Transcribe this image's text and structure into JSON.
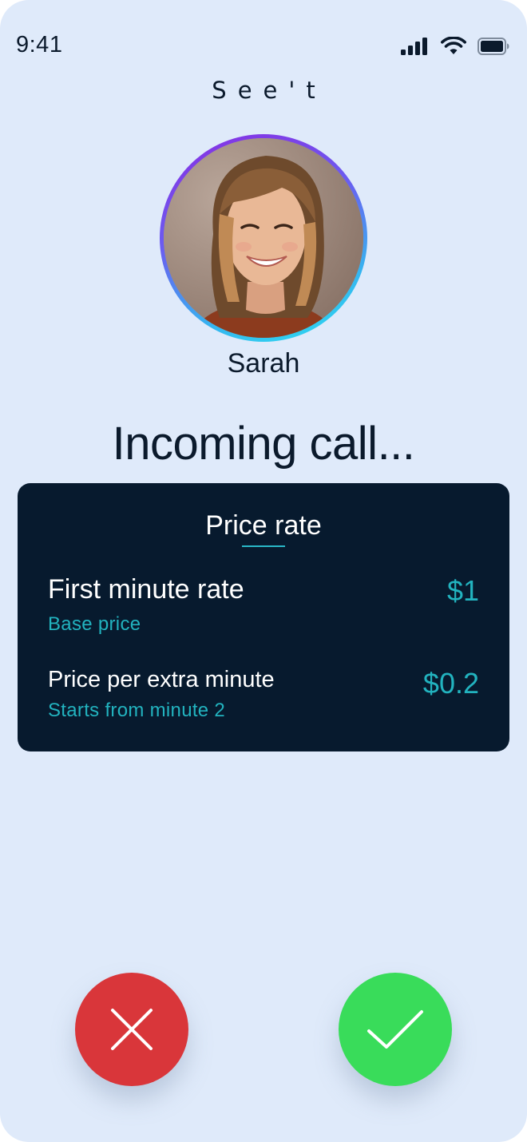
{
  "status_bar": {
    "time": "9:41",
    "icons": [
      "cellular-signal-icon",
      "wifi-icon",
      "battery-icon"
    ]
  },
  "app": {
    "logo_text": "See't"
  },
  "caller": {
    "name": "Sarah",
    "avatar": "caller-photo"
  },
  "call": {
    "status_text": "Incoming call..."
  },
  "price_rate": {
    "title": "Price rate",
    "items": [
      {
        "label": "First minute rate",
        "sublabel": "Base price",
        "value": "$1"
      },
      {
        "label": "Price per extra minute",
        "sublabel": "Starts from minute 2",
        "value": "$0.2"
      }
    ]
  },
  "actions": {
    "decline_icon": "close-icon",
    "accept_icon": "checkmark-icon"
  },
  "colors": {
    "background": "#dfeafa",
    "card_background": "#071a2e",
    "accent_teal": "#22b3bf",
    "decline_red": "#d9363a",
    "accept_green": "#39dc5a",
    "avatar_ring_start": "#8a2be2",
    "avatar_ring_end": "#2be0f0"
  }
}
